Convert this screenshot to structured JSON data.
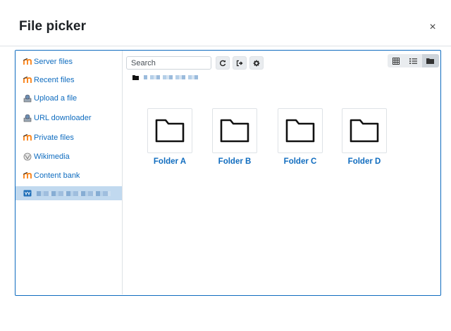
{
  "dialog": {
    "title": "File picker",
    "close_symbol": "×"
  },
  "sidebar": {
    "items": [
      {
        "label": "Server files",
        "icon": "moodle-icon"
      },
      {
        "label": "Recent files",
        "icon": "moodle-icon"
      },
      {
        "label": "Upload a file",
        "icon": "upload-icon"
      },
      {
        "label": "URL downloader",
        "icon": "url-icon"
      },
      {
        "label": "Private files",
        "icon": "moodle-icon"
      },
      {
        "label": "Wikimedia",
        "icon": "wikimedia-icon"
      },
      {
        "label": "Content bank",
        "icon": "moodle-icon"
      }
    ],
    "active_item_icon": "repository-icon"
  },
  "toolbar": {
    "search_placeholder": "Search",
    "buttons": [
      "refresh-icon",
      "logout-icon",
      "settings-icon"
    ],
    "views": [
      "icon-view-icon",
      "list-view-icon",
      "tree-view-icon"
    ]
  },
  "folders": [
    {
      "name": "Folder A"
    },
    {
      "name": "Folder B"
    },
    {
      "name": "Folder C"
    },
    {
      "name": "Folder D"
    }
  ],
  "colors": {
    "accent": "#0f6cbf",
    "active_row": "#c1d9ef",
    "moodle_orange": "#f98012"
  }
}
